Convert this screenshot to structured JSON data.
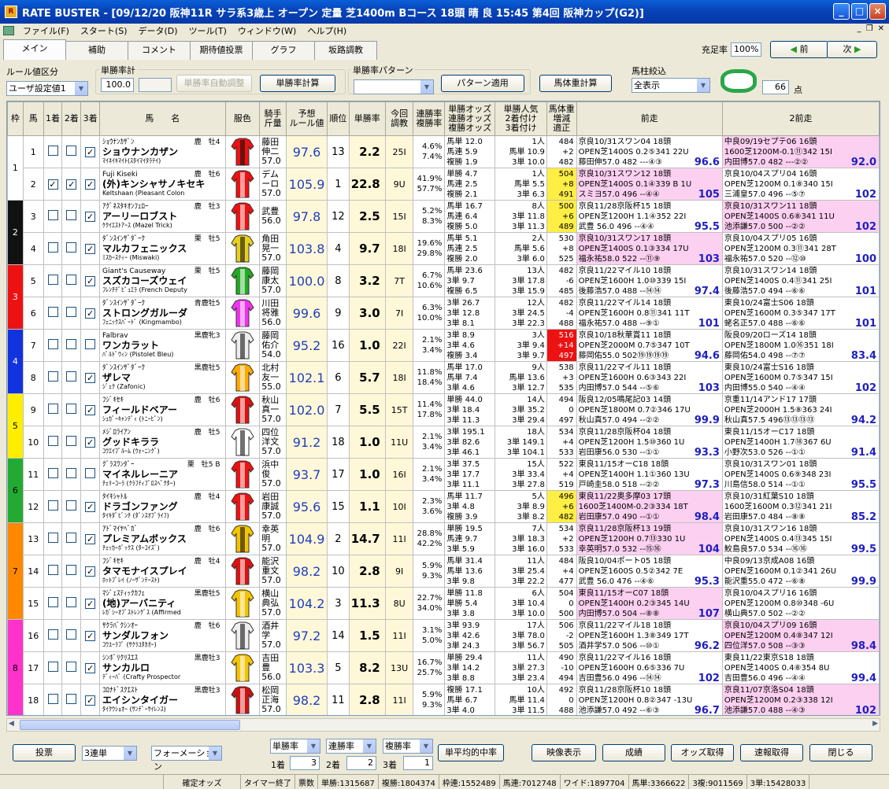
{
  "window": {
    "title": "RATE BUSTER - [09/12/20 阪神11R サラ系3歳上 オープン 定量 芝1400m Bコース 18頭 晴 良 15:45 第4回 阪神カップ(G2)]",
    "min": "_",
    "max": "□",
    "close": "×"
  },
  "menu": [
    "ファイル(F)",
    "スタート(S)",
    "データ(D)",
    "ツール(T)",
    "ウィンドウ(W)",
    "ヘルプ(H)"
  ],
  "tabs": [
    "メイン",
    "補助",
    "コメント",
    "期待値投票",
    "グラフ",
    "坂路調教"
  ],
  "toolbar": {
    "fill_label": "充足率",
    "fill_value": "100%",
    "prev": "前",
    "next": "次",
    "rule_label": "ルール値区分",
    "rule_value": "ユーザ設定値1",
    "winrate_group": "単勝率計",
    "winrate_value": "100.0",
    "auto_adjust": "単勝率自動調整",
    "calc": "単勝率計算",
    "pattern_group": "単勝率パターン",
    "pattern_apply": "パターン適用",
    "weight_calc": "馬体重計算",
    "filter_label": "馬柱絞込",
    "filter_value": "全表示",
    "points": "66",
    "points_unit": "点"
  },
  "headers": [
    "枠",
    "馬",
    "1着",
    "2着",
    "3着",
    "馬　　名",
    "服色",
    "騎手\n斤量",
    "予想\nルール値",
    "順位",
    "単勝率",
    "今回\n調教",
    "連勝率\n複勝率",
    "単勝オッズ\n連勝オッズ\n複勝オッズ",
    "単勝人気\n2着付け\n3着付け",
    "馬体重\n増減\n適正",
    "前走",
    "2前走"
  ],
  "waku_colors": [
    "#ffffff",
    "#111111",
    "#ee1111",
    "#1133dd",
    "#ffee00",
    "#22aa33",
    "#ff8800",
    "#ff33cc"
  ],
  "horses": [
    {
      "w": 1,
      "no": "1",
      "c1": false,
      "c2": false,
      "c3": true,
      "kana": "ｼｮｳﾅﾝｶｻﾞﾝ",
      "sex": "鹿　牡4",
      "name": "ショウナンカザン",
      "sire": "ﾏｲﾈｲｷﾏｲﾄ(ｽﾀｲﾏｲﾀﾗﾃｲ)",
      "jockey": [
        "藤田",
        "伸二",
        "57.0"
      ],
      "rule": "97.6",
      "rank": "13",
      "win": "2.2",
      "train": "25I",
      "rate": [
        "4.6%",
        "7.4%"
      ],
      "odds": [
        "馬単 12.0",
        "馬連 5.9",
        "複勝 1.9"
      ],
      "pop": [
        "1人",
        "馬単 10.9",
        "3単 10.0"
      ],
      "bw": [
        "484",
        "+2",
        "482"
      ],
      "prev": [
        "京良10/31スワン04 18頭",
        "OPEN芝1400S 0.2⑤341 22U",
        "藤田伸57.0 482 ---④③"
      ],
      "prevsc": "96.6",
      "prev2": [
        "中良09/19セプテ06 16頭",
        "1600芝1200M-0.1⑪342 15I",
        "内田博57.0 482 ---②②"
      ],
      "prev2sc": "92.0",
      "h1": "",
      "h2": "#fcd0f0"
    },
    {
      "w": 1,
      "no": "2",
      "c1": true,
      "c2": true,
      "c3": true,
      "kana": "Fuji Kiseki",
      "sex": "鹿　牡6",
      "name": "(外)キンシャサノキセキ",
      "sire": "Keltshaan (Pleasant Colon",
      "jockey": [
        "デム",
        "ーロ",
        "57.0"
      ],
      "rule": "105.9",
      "rank": "1",
      "win": "22.8",
      "train": "9U",
      "rate": [
        "41.9%",
        "57.7%"
      ],
      "odds": [
        "単勝 4.7",
        "馬連 2.5",
        "複勝 2.1"
      ],
      "pop": [
        "1人",
        "馬単 5.5",
        "3単 6.3"
      ],
      "bw": [
        "504",
        "+8",
        "491"
      ],
      "prev": [
        "京良10/31スワン12 18頭",
        "OPEN芝1400S 0.1④339 B 1U",
        "スミヨ57.0 496 --④④"
      ],
      "prevsc": "105",
      "prev2": [
        "京良10/04スプリ04 16頭",
        "OPEN芝1200M 0.1⑧340 15I",
        "三浦皇57.0 496 --⑤⑦"
      ],
      "prev2sc": "102",
      "h1": "#fcd0f0",
      "h2": "",
      "bwh": "#ffee44"
    },
    {
      "w": 2,
      "no": "3",
      "c1": false,
      "c2": false,
      "c3": true,
      "kana": "ｱｸﾞﾈｽﾀｷｵﾝﾌｪﾛｰ",
      "sex": "鹿　牡3",
      "name": "アーリーロブスト",
      "sire": "ｹｸｲｴｽﾄｱｰｽ (Mazel Trick)",
      "jockey": [
        "武豊",
        "",
        "56.0"
      ],
      "rule": "97.8",
      "rank": "12",
      "win": "2.5",
      "train": "15I",
      "rate": [
        "5.2%",
        "8.3%"
      ],
      "odds": [
        "馬単 16.7",
        "馬連 6.4",
        "複勝 5.0"
      ],
      "pop": [
        "8人",
        "3単 11.8",
        "3単 11.3"
      ],
      "bw": [
        "500",
        "+6",
        "489"
      ],
      "prev": [
        "京良11/28京阪杯15 18頭",
        "OPEN芝1200H 1.1④352 22I",
        "武豊 56.0 496 --④④"
      ],
      "prevsc": "95.5",
      "prev2": [
        "京良10/31スワン11 18頭",
        "OPEN芝1400S 0.6⑧341 11U",
        "池添謙57.0 500 --②②"
      ],
      "prev2sc": "102",
      "h1": "",
      "h2": "#fcd0f0",
      "bwh": "#ffee44"
    },
    {
      "w": 2,
      "no": "4",
      "c1": false,
      "c2": false,
      "c3": true,
      "kana": "ﾀﾞﾝｽｲﾝｻﾞﾀﾞｰｸ",
      "sex": "栗　牡5",
      "name": "マルカフェニックス",
      "sire": "ﾐｽｶｰｽﾃｨｰ (Miswaki)",
      "jockey": [
        "角田",
        "晃一",
        "57.0"
      ],
      "rule": "103.8",
      "rank": "4",
      "win": "9.7",
      "train": "18I",
      "rate": [
        "19.6%",
        "29.8%"
      ],
      "odds": [
        "馬単 5.1",
        "馬連 2.5",
        "複勝 2.0"
      ],
      "pop": [
        "2人",
        "馬単 5.6",
        "3単 6.0"
      ],
      "bw": [
        "530",
        "+8",
        "525"
      ],
      "prev": [
        "京良10/31スワン17 18頭",
        "OPEN芝1400S 0.1③334 17U",
        "福永祐58.0 522 --⑪⑨"
      ],
      "prevsc": "103",
      "prev2": [
        "京良10/04スプリ05 16頭",
        "OPEN芝1200M 0.3⑪341 28T",
        "福永祐57.0 520 --⑫⑩"
      ],
      "prev2sc": "100",
      "h1": "#fcd0f0",
      "h2": ""
    },
    {
      "w": 3,
      "no": "5",
      "c1": false,
      "c2": false,
      "c3": true,
      "kana": "Giant's Causeway",
      "sex": "栗　牡5",
      "name": "スズカコーズウェイ",
      "sire": "ﾌﾚﾝﾁﾃﾞﾋﾟｭｴﾗ (French Deputy",
      "jockey": [
        "藤岡",
        "康太",
        "57.0"
      ],
      "rule": "100.0",
      "rank": "8",
      "win": "3.2",
      "train": "7T",
      "rate": [
        "6.7%",
        "10.6%"
      ],
      "odds": [
        "馬単 23.6",
        "3単 9.7",
        "複勝 6.5"
      ],
      "pop": [
        "13人",
        "3単 17.8",
        "3単 15.9"
      ],
      "bw": [
        "482",
        "-6",
        "485"
      ],
      "prev": [
        "京良11/22マイル10 18頭",
        "OPEN芝1600H 1.0⑩339 15I",
        "後藤浩57.0 488 --⑭⑭"
      ],
      "prevsc": "97.4",
      "prev2": [
        "京良10/31スワン14 18頭",
        "OPEN芝1400S 0.4⑪341 25I",
        "後藤浩57.0 494 --⑥⑥"
      ],
      "prev2sc": "101",
      "h1": "",
      "h2": ""
    },
    {
      "w": 3,
      "no": "6",
      "c1": false,
      "c2": false,
      "c3": true,
      "kana": "ﾀﾞﾝｽｲﾝｻﾞﾀﾞｰｸ",
      "sex": "青鹿牡5",
      "name": "ストロングガルーダ",
      "sire": "ﾌｪﾆｯｸｽﾊﾞｰﾄﾞ (Kingmambo)",
      "jockey": [
        "川田",
        "将雅",
        "56.0"
      ],
      "rule": "99.6",
      "rank": "9",
      "win": "3.0",
      "train": "7I",
      "rate": [
        "6.3%",
        "10.0%"
      ],
      "odds": [
        "3単 26.7",
        "3単 12.8",
        "3単 8.1"
      ],
      "pop": [
        "12人",
        "3単 24.5",
        "3単 22.3"
      ],
      "bw": [
        "482",
        "-4",
        "488"
      ],
      "prev": [
        "京良11/22マイル14 18頭",
        "OPEN芝1600H 0.8⑪341 11T",
        "福永祐57.0 488 --⑨①"
      ],
      "prevsc": "101",
      "prev2": [
        "東良10/24富士S06 18頭",
        "OPEN芝1600M 0.3⑤347 17T",
        "蛯名正57.0 488 --⑥⑥"
      ],
      "prev2sc": "101",
      "h1": "",
      "h2": ""
    },
    {
      "w": 4,
      "no": "7",
      "c1": false,
      "c2": false,
      "c3": false,
      "kana": "Falbrav",
      "sex": "黒鹿牝3",
      "name": "ワンカラット",
      "sire": "ﾊﾞﾙﾄﾞｳｨﾝ (Pistolet Bleu)",
      "jockey": [
        "藤岡",
        "佑介",
        "54.0"
      ],
      "rule": "95.2",
      "rank": "16",
      "win": "1.0",
      "train": "22I",
      "rate": [
        "2.1%",
        "3.4%"
      ],
      "odds": [
        "3単 8.9",
        "3単 4.6",
        "複勝 3.4"
      ],
      "pop": [
        "3人",
        "3単 9.4",
        "3単 9.7"
      ],
      "bw": [
        "516",
        "+14",
        "497"
      ],
      "prev": [
        "京良10/18秋華賞11 18頭",
        "OPEN芝2000M 0.7⑤347 10T",
        "藤岡佑55.0 502⑲⑲⑲⑲"
      ],
      "prevsc": "94.6",
      "prev2": [
        "阪良09/20ローズ14 18頭",
        "OPEN芝1800M 1.0⑯351 18I",
        "藤岡佑54.0 498 --⑦⑦"
      ],
      "prev2sc": "83.4",
      "h1": "",
      "h2": "",
      "bwh": "#ee1111"
    },
    {
      "w": 4,
      "no": "8",
      "c1": false,
      "c2": false,
      "c3": true,
      "kana": "ﾀﾞﾝｽｲﾝｻﾞﾀﾞｰｸ",
      "sex": "黒鹿牡5",
      "name": "ザレマ",
      "sire": "ｼﾞｪｸ (Zafonic)",
      "jockey": [
        "北村",
        "友一",
        "55.0"
      ],
      "rule": "102.1",
      "rank": "6",
      "win": "5.7",
      "train": "18I",
      "rate": [
        "11.8%",
        "18.4%"
      ],
      "odds": [
        "馬単 17.0",
        "馬単 7.4",
        "3単 4.6"
      ],
      "pop": [
        "9人",
        "馬単 13.6",
        "3単 12.7"
      ],
      "bw": [
        "538",
        "+3",
        "535"
      ],
      "prev": [
        "京良11/22マイル11 18頭",
        "OPEN芝1600H 0.6③343 22I",
        "内田博57.0 544 --⑤⑥"
      ],
      "prevsc": "103",
      "prev2": [
        "東良10/24富士S16 18頭",
        "OPEN芝1600M 0.7⑤347 15I",
        "内田博55.0 540 --④④"
      ],
      "prev2sc": "102",
      "h1": "",
      "h2": ""
    },
    {
      "w": 5,
      "no": "9",
      "c1": false,
      "c2": false,
      "c3": true,
      "kana": "ﾌｼﾞｷｾｷ",
      "sex": "鹿　牡6",
      "name": "フィールドベアー",
      "sire": "ｼｭｶﾞｰｷｬﾝﾃﾞｨ (ﾄﾆｰﾋﾞﾝ)",
      "jockey": [
        "秋山",
        "真一",
        "57.0"
      ],
      "rule": "102.0",
      "rank": "7",
      "win": "5.5",
      "train": "15T",
      "rate": [
        "11.4%",
        "17.8%"
      ],
      "odds": [
        "単勝 44.0",
        "3単 18.4",
        "3単 11.3"
      ],
      "pop": [
        "14人",
        "3単 35.2",
        "3単 29.4"
      ],
      "bw": [
        "494",
        "0",
        "497"
      ],
      "prev": [
        "阪良12/05鳴尾記03 14頭",
        "OPEN芝1800M 0.7②346 17U",
        "秋山真57.0 494 --②②"
      ],
      "prevsc": "99.9",
      "prev2": [
        "京重11/14アンド17 17頭",
        "OPEN芝2000H 1.5⑧363 24I",
        "秋山真57.5 496⑬⑬⑬⑬"
      ],
      "prev2sc": "94.2",
      "h1": "",
      "h2": ""
    },
    {
      "w": 5,
      "no": "10",
      "c1": false,
      "c2": false,
      "c3": true,
      "kana": "ﾒｼﾞﾛﾗｲｱﾝ",
      "sex": "鹿　牡5",
      "name": "グッドキララ",
      "sire": "ｺｳｴｲﾌﾞﾙｰﾑ (ｳｫｰﾆﾝｸﾞ)",
      "jockey": [
        "四位",
        "洋文",
        "57.0"
      ],
      "rule": "91.2",
      "rank": "18",
      "win": "1.0",
      "train": "11U",
      "rate": [
        "2.1%",
        "3.4%"
      ],
      "odds": [
        "3単 195.1",
        "3単 82.6",
        "3単 46.1"
      ],
      "pop": [
        "18人",
        "3単 149.1",
        "3単 104.1"
      ],
      "bw": [
        "534",
        "+4",
        "533"
      ],
      "prev": [
        "京良11/28京阪杯04 18頭",
        "OPEN芝1200H 1.5⑩360 1U",
        "岩田康56.0 530 --①①"
      ],
      "prevsc": "93.3",
      "prev2": [
        "東良11/15オーC17 18頭",
        "OPEN芝1400H 1.7⑱367 6U",
        "小野次53.0 526 --①①"
      ],
      "prev2sc": "91.4",
      "h1": "",
      "h2": ""
    },
    {
      "w": 6,
      "no": "11",
      "c1": false,
      "c2": false,
      "c3": false,
      "kana": "ｸﾞﾗｽﾜﾝﾀﾞｰ",
      "sex": "栗　牡5 B",
      "name": "マイネルレーニア",
      "sire": "ﾁｪﾘｰｺｰﾗ (ｸﾗﾌﾃｨﾌﾟﾛｽﾍﾟｸﾀｰ)",
      "jockey": [
        "浜中",
        "俊",
        "57.0"
      ],
      "rule": "93.7",
      "rank": "17",
      "win": "1.0",
      "train": "16I",
      "rate": [
        "2.1%",
        "3.4%"
      ],
      "odds": [
        "3単 37.5",
        "3単 17.7",
        "3単 11.1"
      ],
      "pop": [
        "15人",
        "3単 33.4",
        "3単 27.8"
      ],
      "bw": [
        "522",
        "+4",
        "519"
      ],
      "prev": [
        "東良11/15オーC18 18頭",
        "OPEN芝1400H 1.1①360 13U",
        "戸崎圭58.0 518 --②②"
      ],
      "prevsc": "97.3",
      "prev2": [
        "京良10/31スワン01 18頭",
        "OPEN芝1400S 0.6⑨348 23I",
        "川島信58.0 514 --①①"
      ],
      "prev2sc": "95.5",
      "h1": "",
      "h2": ""
    },
    {
      "w": 6,
      "no": "12",
      "c1": false,
      "c2": false,
      "c3": true,
      "kana": "ﾀｲｷｼｬﾄﾙ",
      "sex": "鹿　牡4",
      "name": "ドラゴンファング",
      "sire": "ﾀｲｷﾀﾞﾋﾞﾝﾁ (ﾀﾞﾝｽｵﾌﾞﾗｲﾌ)",
      "jockey": [
        "岩田",
        "康誠",
        "57.0"
      ],
      "rule": "95.6",
      "rank": "15",
      "win": "1.1",
      "train": "10I",
      "rate": [
        "2.3%",
        "3.6%"
      ],
      "odds": [
        "馬単 11.7",
        "3単 4.8",
        "複勝 3.9"
      ],
      "pop": [
        "5人",
        "3単 8.9",
        "3単 8.2"
      ],
      "bw": [
        "496",
        "+6",
        "482"
      ],
      "prev": [
        "東良11/22奥多摩03 17頭",
        "1600芝1400M-0.2③334 18T",
        "岩田康57.0 490 --①①"
      ],
      "prevsc": "98.4",
      "prev2": [
        "京良10/31紅葉S10 18頭",
        "1600芝1600M 0.3⑫341 21I",
        "岩田康57.0 484 --⑧⑧"
      ],
      "prev2sc": "85.2",
      "h1": "#fcd0f0",
      "h2": "",
      "bwh": "#ffee44"
    },
    {
      "w": 7,
      "no": "13",
      "c1": false,
      "c2": false,
      "c3": true,
      "kana": "ｱﾄﾞﾏｲﾔﾍﾞｶﾞ",
      "sex": "鹿　牡6",
      "name": "プレミアムボックス",
      "sire": "ﾁｪｯｶｰﾎﾞｯｸｽ (ﾀｰｺｲｽﾞ)",
      "jockey": [
        "幸英",
        "明",
        "57.0"
      ],
      "rule": "104.9",
      "rank": "2",
      "win": "14.7",
      "train": "11I",
      "rate": [
        "28.8%",
        "42.2%"
      ],
      "odds": [
        "単勝 19.5",
        "馬連 9.7",
        "3単 5.9"
      ],
      "pop": [
        "7人",
        "3単 18.3",
        "3単 16.0"
      ],
      "bw": [
        "534",
        "+2",
        "533"
      ],
      "prev": [
        "京良11/28京阪杯13 19頭",
        "OPEN芝1200H 0.7⑬330 1U",
        "幸英明57.0 532 --⑮⑯"
      ],
      "prevsc": "104",
      "prev2": [
        "京良10/31スワン16 18頭",
        "OPEN芝1400S 0.4⑬345 15I",
        "鮫島良57.0 534 --⑯⑯"
      ],
      "prev2sc": "99.5",
      "h1": "#fcd0f0",
      "h2": ""
    },
    {
      "w": 7,
      "no": "14",
      "c1": false,
      "c2": false,
      "c3": true,
      "kana": "ﾌｼﾞｷｾｷ",
      "sex": "鹿　牡4",
      "name": "タマモナイスプレイ",
      "sire": "ﾎｯﾄﾌﾟﾚｲ (ﾉｰｻﾞﾝﾃｰｽﾄ)",
      "jockey": [
        "能沢",
        "重文",
        "57.0"
      ],
      "rule": "98.2",
      "rank": "10",
      "win": "2.8",
      "train": "9I",
      "rate": [
        "5.9%",
        "9.3%"
      ],
      "odds": [
        "馬単 31.4",
        "馬単 13.6",
        "3単 9.8"
      ],
      "pop": [
        "11人",
        "3単 25.4",
        "3単 22.2"
      ],
      "bw": [
        "484",
        "+4",
        "477"
      ],
      "prev": [
        "阪良10/04ポート05 18頭",
        "OPEN芝1600S 0.5②342 7E",
        "武豊 56.0 476 --④⑥"
      ],
      "prevsc": "95.3",
      "prev2": [
        "中良09/13京成A08 16頭",
        "OPEN芝1600M 0.1②341 26U",
        "能沢重55.0 472 --⑥⑧"
      ],
      "prev2sc": "99.9",
      "h1": "",
      "h2": ""
    },
    {
      "w": 7,
      "no": "15",
      "c1": false,
      "c2": false,
      "c3": true,
      "kana": "ﾏｼﾞｪｽﾃｨｯｸｶﾌｪ",
      "sex": "黒鹿牡5",
      "name": "(地)アーバニティ",
      "sire": "ﾚｶﾞｼｰｵﾌﾞｽﾄﾚﾝｸﾞｽ (Affirmed",
      "jockey": [
        "横山",
        "典弘",
        "57.0"
      ],
      "rule": "104.2",
      "rank": "3",
      "win": "11.3",
      "train": "8U",
      "rate": [
        "22.7%",
        "34.0%"
      ],
      "odds": [
        "単勝 11.8",
        "単勝 5.4",
        "3単 3.8"
      ],
      "pop": [
        "6人",
        "3単 10.4",
        "3単 10.0"
      ],
      "bw": [
        "504",
        "0",
        "500"
      ],
      "prev": [
        "東良11/15オーC07 18頭",
        "OPEN芝1400H 0.2③345 14U",
        "内田博57.0 504 --⑧⑧"
      ],
      "prevsc": "107",
      "prev2": [
        "京良10/04スプリ16 16頭",
        "OPEN芝1200M 0.8⑩348 -6U",
        "横山典57.0 502 --②②"
      ],
      "prev2sc": "",
      "h1": "#fcd0f0",
      "h2": ""
    },
    {
      "w": 8,
      "no": "16",
      "c1": false,
      "c2": false,
      "c3": true,
      "kana": "ｻｸﾗﾊﾞｸｼﾝｵｰ",
      "sex": "鹿　牡6",
      "name": "サンダルフォン",
      "sire": "ｺｳﾕｰﾗﾌﾞ (ｻｸﾗﾕﾀｶｵｰ)",
      "jockey": [
        "酒井",
        "学",
        "57.0"
      ],
      "rule": "97.2",
      "rank": "14",
      "win": "1.5",
      "train": "11I",
      "rate": [
        "3.1%",
        "5.0%"
      ],
      "odds": [
        "3単 93.9",
        "3単 42.6",
        "3単 24.3"
      ],
      "pop": [
        "17人",
        "3単 78.0",
        "3単 56.7"
      ],
      "bw": [
        "506",
        "-2",
        "505"
      ],
      "prev": [
        "京良11/22マイル18 18頭",
        "OPEN芝1600H 1.3⑧349 17T",
        "酒井学57.0 506 --⑩①"
      ],
      "prevsc": "96.2",
      "prev2": [
        "京良10/04スプリ09 16頭",
        "OPEN芝1200M 0.4⑧347 12I",
        "四位洋57.0 508 --③③"
      ],
      "prev2sc": "98.4",
      "h1": "",
      "h2": "#fcd0f0"
    },
    {
      "w": 8,
      "no": "17",
      "c1": false,
      "c2": false,
      "c3": true,
      "kana": "ｼﾝﾎﾞﾘｸﾘｽｴｽ",
      "sex": "黒鹿牡3",
      "name": "サンカルロ",
      "sire": "ﾃﾞｨｰﾊﾞ (Crafty Prospector",
      "jockey": [
        "吉田",
        "豊",
        "56.0"
      ],
      "rule": "103.3",
      "rank": "5",
      "win": "8.2",
      "train": "13U",
      "rate": [
        "16.7%",
        "25.7%"
      ],
      "odds": [
        "単勝 29.4",
        "3単 14.2",
        "3単 8.8"
      ],
      "pop": [
        "11人",
        "3単 27.3",
        "3単 23.4"
      ],
      "bw": [
        "490",
        "-10",
        "494"
      ],
      "prev": [
        "京良11/22マイル16 18頭",
        "OPEN芝1600H 0.6⑤336 7U",
        "吉田豊56.0 496 --⑭⑭"
      ],
      "prevsc": "102",
      "prev2": [
        "東良11/22東京S18 18頭",
        "OPEN芝1400S 0.4⑧354 8U",
        "吉田豊56.0 496 --④④"
      ],
      "prev2sc": "99.4",
      "h1": "",
      "h2": ""
    },
    {
      "w": 8,
      "no": "18",
      "c1": false,
      "c2": false,
      "c3": true,
      "kana": "ｺﾛﾅﾄﾞｽｸｴｽﾄ",
      "sex": "黒鹿牡3",
      "name": "エイシンタイガー",
      "sire": "ﾀｲｸｳｼｮｵｰ (ｻﾝﾃﾞｰｻｲﾚﾝｽ)",
      "jockey": [
        "松岡",
        "正海",
        "57.0"
      ],
      "rule": "98.2",
      "rank": "11",
      "win": "2.8",
      "train": "11I",
      "rate": [
        "5.9%",
        "9.3%"
      ],
      "odds": [
        "複勝 17.1",
        "馬単 6.7",
        "3単 4.0"
      ],
      "pop": [
        "10人",
        "馬単 11.4",
        "3単 11.5"
      ],
      "bw": [
        "492",
        "0",
        "488"
      ],
      "prev": [
        "京良11/28京阪杯10 18頭",
        "OPEN芝1200H 0.8②347 -13U",
        "池添謙57.0 492 --⑥③"
      ],
      "prevsc": "96.7",
      "prev2": [
        "京良11/07京洛S04 18頭",
        "OPEN芝1200M 0.2③338 12I",
        "池添謙57.0 488 --④③"
      ],
      "prev2sc": "102",
      "h1": "",
      "h2": "#fcd0f0"
    }
  ],
  "bottom": {
    "vote": "投票",
    "bet_type": "3連単",
    "formation": "フォーメーション",
    "s1": "単勝率",
    "s2": "連勝率",
    "s3": "複勝率",
    "avg": "単平均的中率",
    "video": "映像表示",
    "result": "成績",
    "odds_get": "オッズ取得",
    "fast_get": "速報取得",
    "close": "閉じる",
    "l1": "1着",
    "v1": "3",
    "l2": "2着",
    "v2": "2",
    "l3": "3着",
    "v3": "1"
  },
  "status": [
    "",
    "確定オッズ",
    "タイマー終了",
    "票数",
    "単勝:1315687",
    "複勝:1804374",
    "枠連:1552489",
    "馬連:7012748",
    "ワイド:1897704",
    "馬単:3366622",
    "3複:9011569",
    "3単:15428033"
  ]
}
